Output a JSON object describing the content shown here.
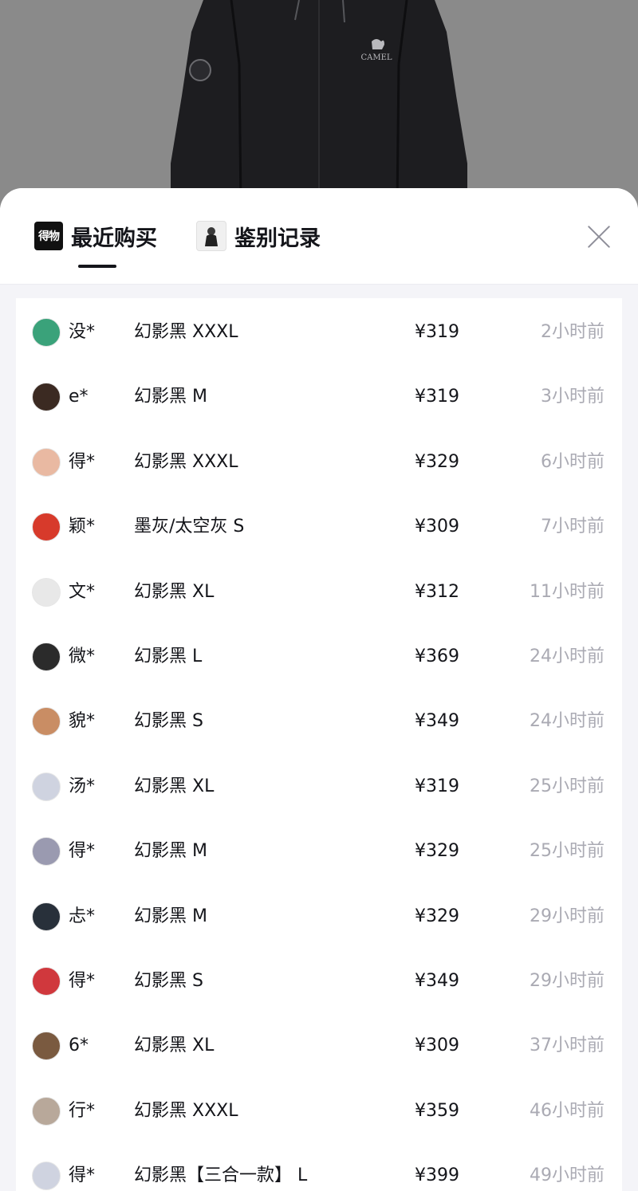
{
  "tabs": [
    {
      "label": "最近购买",
      "icon": "dewu-logo-icon",
      "logo_text": "得物",
      "active": true
    },
    {
      "label": "鉴别记录",
      "icon": "jacket-thumbnail-icon",
      "active": false
    }
  ],
  "product": {
    "brand_text": "CAMEL"
  },
  "purchases": [
    {
      "user": "没*",
      "spec": "幻影黑 XXXL",
      "price": "¥319",
      "time": "2小时前",
      "avatar_color": "#3aa27a"
    },
    {
      "user": "e*",
      "spec": "幻影黑 M",
      "price": "¥319",
      "time": "3小时前",
      "avatar_color": "#3b2a22"
    },
    {
      "user": "得*",
      "spec": "幻影黑 XXXL",
      "price": "¥329",
      "time": "6小时前",
      "avatar_color": "#e9b9a2"
    },
    {
      "user": "颖*",
      "spec": "墨灰/太空灰 S",
      "price": "¥309",
      "time": "7小时前",
      "avatar_color": "#d73a2b"
    },
    {
      "user": "文*",
      "spec": "幻影黑 XL",
      "price": "¥312",
      "time": "11小时前",
      "avatar_color": "#e8e8e8"
    },
    {
      "user": "微*",
      "spec": "幻影黑 L",
      "price": "¥369",
      "time": "24小时前",
      "avatar_color": "#2b2b2b"
    },
    {
      "user": "貌*",
      "spec": "幻影黑 S",
      "price": "¥349",
      "time": "24小时前",
      "avatar_color": "#c98d64"
    },
    {
      "user": "汤*",
      "spec": "幻影黑 XL",
      "price": "¥319",
      "time": "25小时前",
      "avatar_color": "#cfd3e0"
    },
    {
      "user": "得*",
      "spec": "幻影黑 M",
      "price": "¥329",
      "time": "25小时前",
      "avatar_color": "#9a9ab0"
    },
    {
      "user": "忐*",
      "spec": "幻影黑 M",
      "price": "¥329",
      "time": "29小时前",
      "avatar_color": "#28303a"
    },
    {
      "user": "得*",
      "spec": "幻影黑 S",
      "price": "¥349",
      "time": "29小时前",
      "avatar_color": "#d0383d"
    },
    {
      "user": "6*",
      "spec": "幻影黑 XL",
      "price": "¥309",
      "time": "37小时前",
      "avatar_color": "#7a5a40"
    },
    {
      "user": "行*",
      "spec": "幻影黑 XXXL",
      "price": "¥359",
      "time": "46小时前",
      "avatar_color": "#b8a89a"
    },
    {
      "user": "得*",
      "spec": "幻影黑【三合一款】 L",
      "price": "¥399",
      "time": "49小时前",
      "avatar_color": "#cfd3e0"
    }
  ]
}
